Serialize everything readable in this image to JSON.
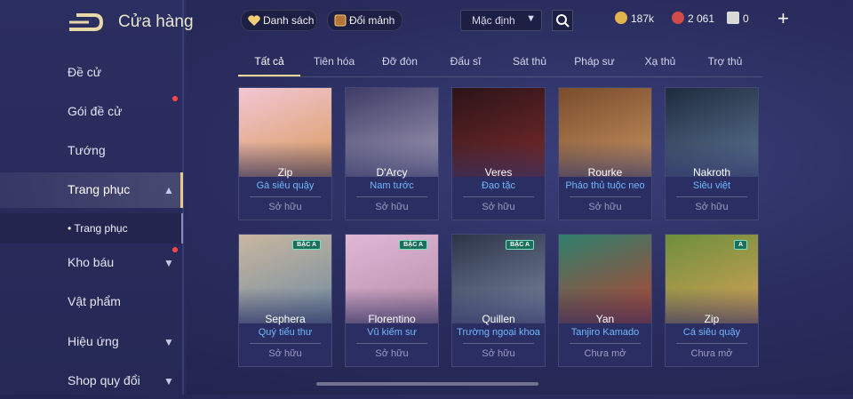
{
  "header": {
    "title": "Cửa hàng"
  },
  "sidebar": {
    "items": [
      {
        "label": "Đề cử"
      },
      {
        "label": "Gói đề cử"
      },
      {
        "label": "Tướng"
      },
      {
        "label": "Trang phục"
      },
      {
        "label": "Kho báu"
      },
      {
        "label": "Vật phẩm"
      },
      {
        "label": "Hiệu ứng"
      },
      {
        "label": "Shop quy đổi"
      }
    ],
    "sub_item": "• Trang phục"
  },
  "topbar": {
    "list_button": "Danh sách",
    "exchange_button": "Đổi mảnh",
    "sort_select": "Mặc định",
    "currencies": [
      {
        "value": "187k",
        "icon": "gold-coin-icon",
        "color": "#e0b64c"
      },
      {
        "value": "2 061",
        "icon": "ruby-icon",
        "color": "#d04a4a"
      },
      {
        "value": "0",
        "icon": "voucher-icon",
        "color": "#d9d9d9"
      }
    ]
  },
  "tabs": [
    "Tất cả",
    "Tiên hóa",
    "Đỡ đòn",
    "Đấu sĩ",
    "Sát thủ",
    "Pháp sư",
    "Xạ thủ",
    "Trợ thủ"
  ],
  "cards": [
    {
      "hero": "Zip",
      "skin": "Gà siêu quậy",
      "status": "Sở hữu",
      "colors": [
        "#f2c6d4",
        "#d89a5b"
      ]
    },
    {
      "hero": "D'Arcy",
      "skin": "Nam tước",
      "status": "Sở hữu",
      "colors": [
        "#3e3b66",
        "#a59fb8"
      ]
    },
    {
      "hero": "Veres",
      "skin": "Đạo tặc",
      "status": "Sở hữu",
      "colors": [
        "#2b1418",
        "#7d2b2c"
      ]
    },
    {
      "hero": "Rourke",
      "skin": "Pháo thủ tuộc neo",
      "status": "Sở hữu",
      "colors": [
        "#7a4c2b",
        "#c79463"
      ]
    },
    {
      "hero": "Nakroth",
      "skin": "Siêu việt",
      "status": "Sở hữu",
      "colors": [
        "#1f2b3e",
        "#5e7896"
      ]
    },
    {
      "hero": "Sephera",
      "skin": "Quý tiểu thư",
      "status": "Sở hữu",
      "colors": [
        "#c9b7a0",
        "#6f8aa1"
      ],
      "badge": "BẬC A"
    },
    {
      "hero": "Florentino",
      "skin": "Vũ kiếm sư",
      "status": "Sở hữu",
      "colors": [
        "#e0b8d8",
        "#b58ba6"
      ],
      "badge": "BẬC A"
    },
    {
      "hero": "Quillen",
      "skin": "Trường ngoại khoa",
      "status": "Sở hữu",
      "colors": [
        "#2c3448",
        "#7d8aa4"
      ],
      "badge": "BẬC A"
    },
    {
      "hero": "Yan",
      "skin": "Tanjiro Kamado",
      "status": "Chưa mở",
      "colors": [
        "#2f7f6e",
        "#b9422d"
      ]
    },
    {
      "hero": "Zip",
      "skin": "Cá siêu quậy",
      "status": "Chưa mở",
      "colors": [
        "#6d8f3c",
        "#d8a257"
      ],
      "badge": "A"
    }
  ]
}
